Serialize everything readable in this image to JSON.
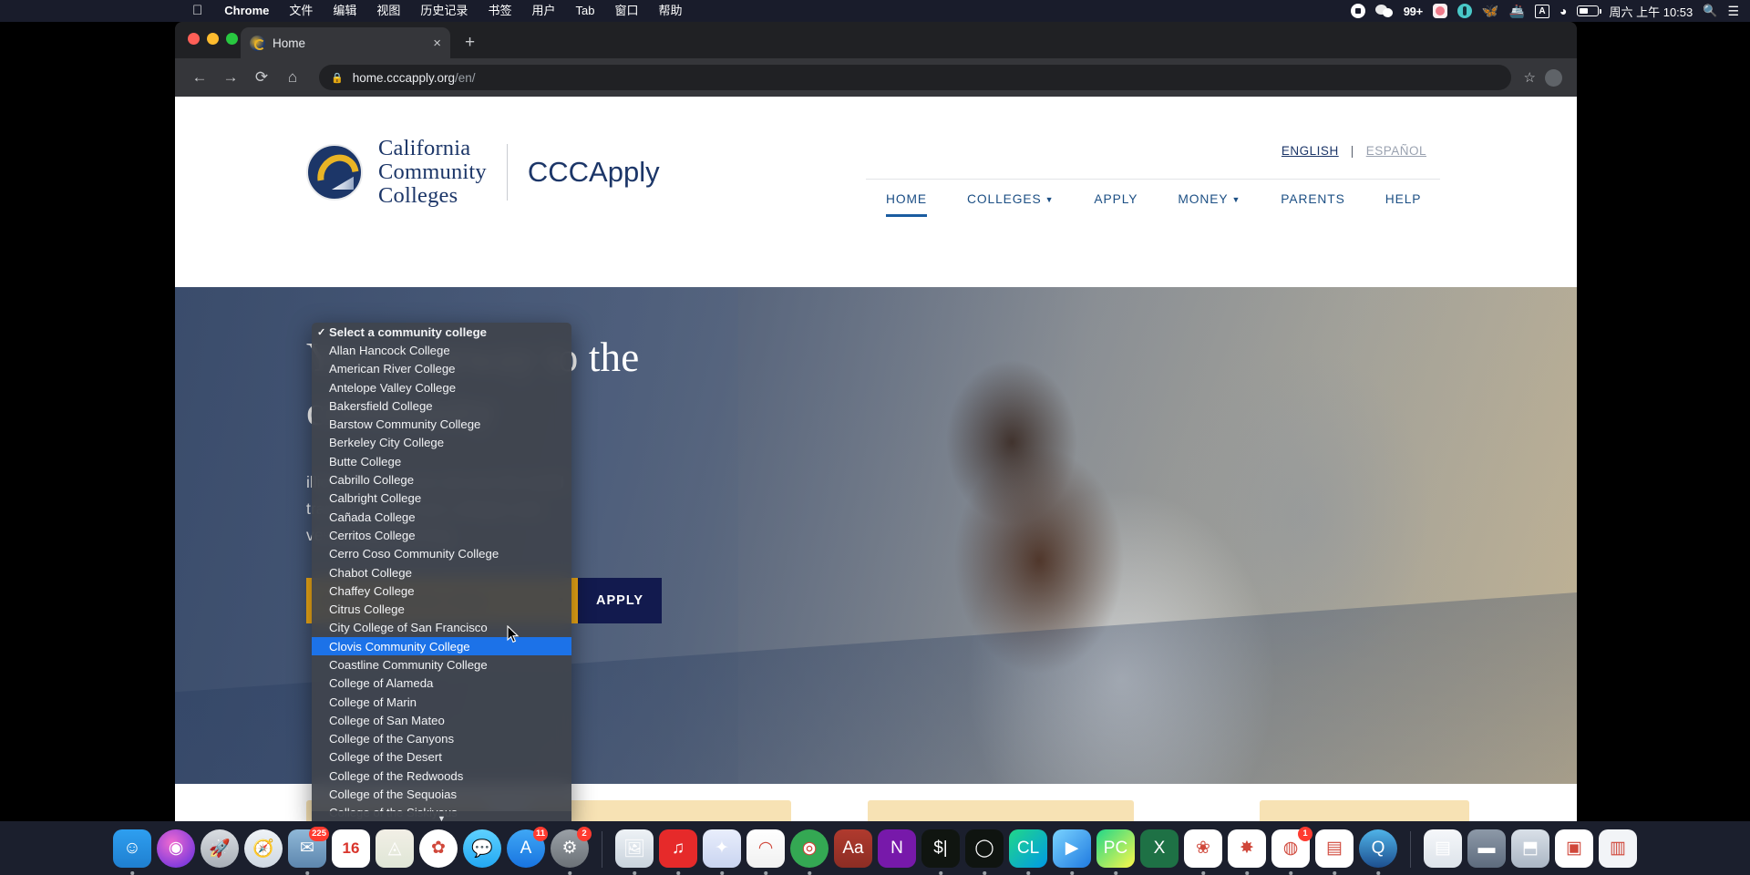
{
  "menubar": {
    "apple_icon": "apple-icon",
    "items": [
      "Chrome",
      "文件",
      "编辑",
      "视图",
      "历史记录",
      "书签",
      "用户",
      "Tab",
      "窗口",
      "帮助"
    ],
    "status": {
      "record_icon": "record-circle-icon",
      "wechat_icon": "wechat-icon",
      "badge_count": "99+",
      "pink_app_icon": "pink-app-icon",
      "teal_app_icon": "teal-app-icon",
      "bird_icon": "bird-icon",
      "docker_icon": "docker-icon",
      "input_source": "A",
      "wifi_icon": "wifi-icon",
      "battery_icon": "battery-icon",
      "clock": "周六 上午 10:53",
      "search_icon": "spotlight-search-icon",
      "controlcenter_icon": "control-center-icon"
    }
  },
  "browser": {
    "tab": {
      "title": "Home",
      "favicon": "cccapply-favicon",
      "close_icon": "close-icon"
    },
    "newtab_icon": "new-tab-plus-icon",
    "toolbar": {
      "back_icon": "back-arrow-icon",
      "forward_icon": "forward-arrow-icon",
      "reload_icon": "reload-icon",
      "home_icon": "home-icon",
      "lock_icon": "lock-icon",
      "url_host": "home.cccapply.org",
      "url_path": "/en/",
      "bookmark_icon": "star-bookmark-icon",
      "profile_icon": "profile-avatar-icon"
    }
  },
  "site": {
    "logo": {
      "seal_icon": "california-community-colleges-seal",
      "line1": "California",
      "line2": "Community",
      "line3": "Colleges",
      "brand": "CCCApply"
    },
    "language": {
      "english": "ENGLISH",
      "separator": "|",
      "espanol": "ESPAÑOL"
    },
    "nav": [
      {
        "label": "HOME",
        "has_caret": false,
        "active": true
      },
      {
        "label": "COLLEGES",
        "has_caret": true,
        "active": false
      },
      {
        "label": "APPLY",
        "has_caret": false,
        "active": false
      },
      {
        "label": "MONEY",
        "has_caret": true,
        "active": false
      },
      {
        "label": "PARENTS",
        "has_caret": false,
        "active": false
      },
      {
        "label": "HELP",
        "has_caret": false,
        "active": false
      }
    ],
    "hero": {
      "title_line1": "Your gateway to the",
      "title_line2": "community",
      "body_line1": "illion students from all over the world",
      "body_line2": "transfer to four-year colleges and",
      "body_line3": "ves through learning.",
      "select_value": "Select a community college",
      "select_caret": "chevron-down-icon",
      "apply_label": "APPLY"
    }
  },
  "dropdown": {
    "checkmark": "✓",
    "scroll_arrow": "▼",
    "selected_index": 17,
    "options": [
      "Select a community college",
      "Allan Hancock College",
      "American River College",
      "Antelope Valley College",
      "Bakersfield College",
      "Barstow Community College",
      "Berkeley City College",
      "Butte College",
      "Cabrillo College",
      "Calbright College",
      "Cañada College",
      "Cerritos College",
      "Cerro Coso Community College",
      "Chabot College",
      "Chaffey College",
      "Citrus College",
      "City College of San Francisco",
      "Clovis Community College",
      "Coastline Community College",
      "College of Alameda",
      "College of Marin",
      "College of San Mateo",
      "College of the Canyons",
      "College of the Desert",
      "College of the Redwoods",
      "College of the Sequoias",
      "College of the Siskiyous"
    ]
  },
  "dock": {
    "items": [
      {
        "name": "finder",
        "glyph": "☺",
        "bg": "linear-gradient(180deg,#2e9ff0,#1f7fd0)",
        "round": false,
        "running": true
      },
      {
        "name": "siri",
        "glyph": "◉",
        "bg": "radial-gradient(circle at 40% 35%,#f06bd0,#5b2ae0)",
        "round": true,
        "running": false
      },
      {
        "name": "launchpad",
        "glyph": "🚀",
        "bg": "linear-gradient(180deg,#d9dde2,#a8aeb6)",
        "round": true,
        "running": false
      },
      {
        "name": "safari",
        "glyph": "🧭",
        "bg": "linear-gradient(180deg,#eff3f7,#cfd8e2)",
        "round": true,
        "running": false
      },
      {
        "name": "mail",
        "glyph": "✉",
        "bg": "linear-gradient(180deg,#8fb8d8,#5d86ae)",
        "round": false,
        "running": true,
        "badge": "225"
      },
      {
        "name": "calendar",
        "glyph": "16",
        "bg": "#ffffff",
        "round": false,
        "running": false,
        "calendar": true
      },
      {
        "name": "maps",
        "glyph": "◬",
        "bg": "linear-gradient(180deg,#f2efe6,#dfe6d6)",
        "round": false,
        "running": false
      },
      {
        "name": "photos",
        "glyph": "✿",
        "bg": "#ffffff",
        "round": true,
        "running": false
      },
      {
        "name": "messages",
        "glyph": "💬",
        "bg": "linear-gradient(180deg,#5ed1ff,#23a8f2)",
        "round": true,
        "running": false
      },
      {
        "name": "app-store",
        "glyph": "A",
        "bg": "linear-gradient(180deg,#3fa7f5,#1874e0)",
        "round": true,
        "running": false,
        "badge": "11"
      },
      {
        "name": "system-preferences",
        "glyph": "⚙",
        "bg": "linear-gradient(180deg,#9aa0a6,#6b7177)",
        "round": true,
        "running": true,
        "badge": "2"
      },
      {
        "name": "separator-1",
        "glyph": "",
        "separator": true
      },
      {
        "name": "preview",
        "glyph": "🖼",
        "bg": "linear-gradient(180deg,#eef2f6,#c9d3dd)",
        "round": false,
        "running": true
      },
      {
        "name": "netease-music",
        "glyph": "♫",
        "bg": "#e62a2a",
        "round": false,
        "running": true
      },
      {
        "name": "dove-app",
        "glyph": "✦",
        "bg": "linear-gradient(180deg,#e9eefc,#c9d4f0)",
        "round": false,
        "running": true
      },
      {
        "name": "rainbow-app",
        "glyph": "◠",
        "bg": "linear-gradient(180deg,#ffffff,#f0f0f0)",
        "round": false,
        "running": true
      },
      {
        "name": "google-chrome",
        "glyph": "◎",
        "bg": "radial-gradient(circle at 50% 50%,#fff 22%,#34a853 23%)",
        "round": true,
        "running": true
      },
      {
        "name": "dictionary",
        "glyph": "Aa",
        "bg": "linear-gradient(180deg,#b03a2e,#8c2d24)",
        "round": false,
        "running": false
      },
      {
        "name": "onenote",
        "glyph": "N",
        "bg": "#7719aa",
        "round": false,
        "running": false
      },
      {
        "name": "terminal-green",
        "glyph": "$|",
        "bg": "#101510",
        "round": false,
        "running": true
      },
      {
        "name": "circle-loop-app",
        "glyph": "◯",
        "bg": "#0f1410",
        "round": false,
        "running": true
      },
      {
        "name": "clion",
        "glyph": "CL",
        "bg": "linear-gradient(135deg,#21d789,#009ae5)",
        "round": false,
        "running": true
      },
      {
        "name": "media-player",
        "glyph": "▶",
        "bg": "linear-gradient(135deg,#7ad3ff,#1f7ae0)",
        "round": false,
        "running": true
      },
      {
        "name": "pycharm",
        "glyph": "PC",
        "bg": "linear-gradient(135deg,#21d789,#fcf84a)",
        "round": false,
        "running": true
      },
      {
        "name": "excel",
        "glyph": "X",
        "bg": "#1e7145",
        "round": false,
        "running": false
      },
      {
        "name": "alfred-like",
        "glyph": "❀",
        "bg": "#ffffff",
        "round": false,
        "running": true
      },
      {
        "name": "orange-flower",
        "glyph": "✸",
        "bg": "#ffffff",
        "round": false,
        "running": true
      },
      {
        "name": "wechat",
        "glyph": "◍",
        "bg": "#ffffff",
        "round": false,
        "running": true,
        "badge": "1"
      },
      {
        "name": "pages-docs",
        "glyph": "▤",
        "bg": "#ffffff",
        "round": false,
        "running": true
      },
      {
        "name": "quicktime",
        "glyph": "Q",
        "bg": "linear-gradient(180deg,#4fb3e8,#1d4f8f)",
        "round": true,
        "running": true
      },
      {
        "name": "separator-2",
        "glyph": "",
        "separator": true
      },
      {
        "name": "downloads-file",
        "glyph": "▤",
        "bg": "linear-gradient(180deg,#f5f7fa,#dde3ea)",
        "round": false,
        "running": false
      },
      {
        "name": "stack-small",
        "glyph": "▬",
        "bg": "linear-gradient(180deg,#8d99a8,#5d6b7d)",
        "round": false,
        "running": false
      },
      {
        "name": "stack-red",
        "glyph": "⬒",
        "bg": "linear-gradient(180deg,#d9e0e8,#aab6c4)",
        "round": false,
        "running": false
      },
      {
        "name": "screenshot-1",
        "glyph": "▣",
        "bg": "#ffffff",
        "round": false,
        "running": false
      },
      {
        "name": "screenshot-2",
        "glyph": "▥",
        "bg": "#f2f4f7",
        "round": false,
        "running": false
      }
    ]
  }
}
